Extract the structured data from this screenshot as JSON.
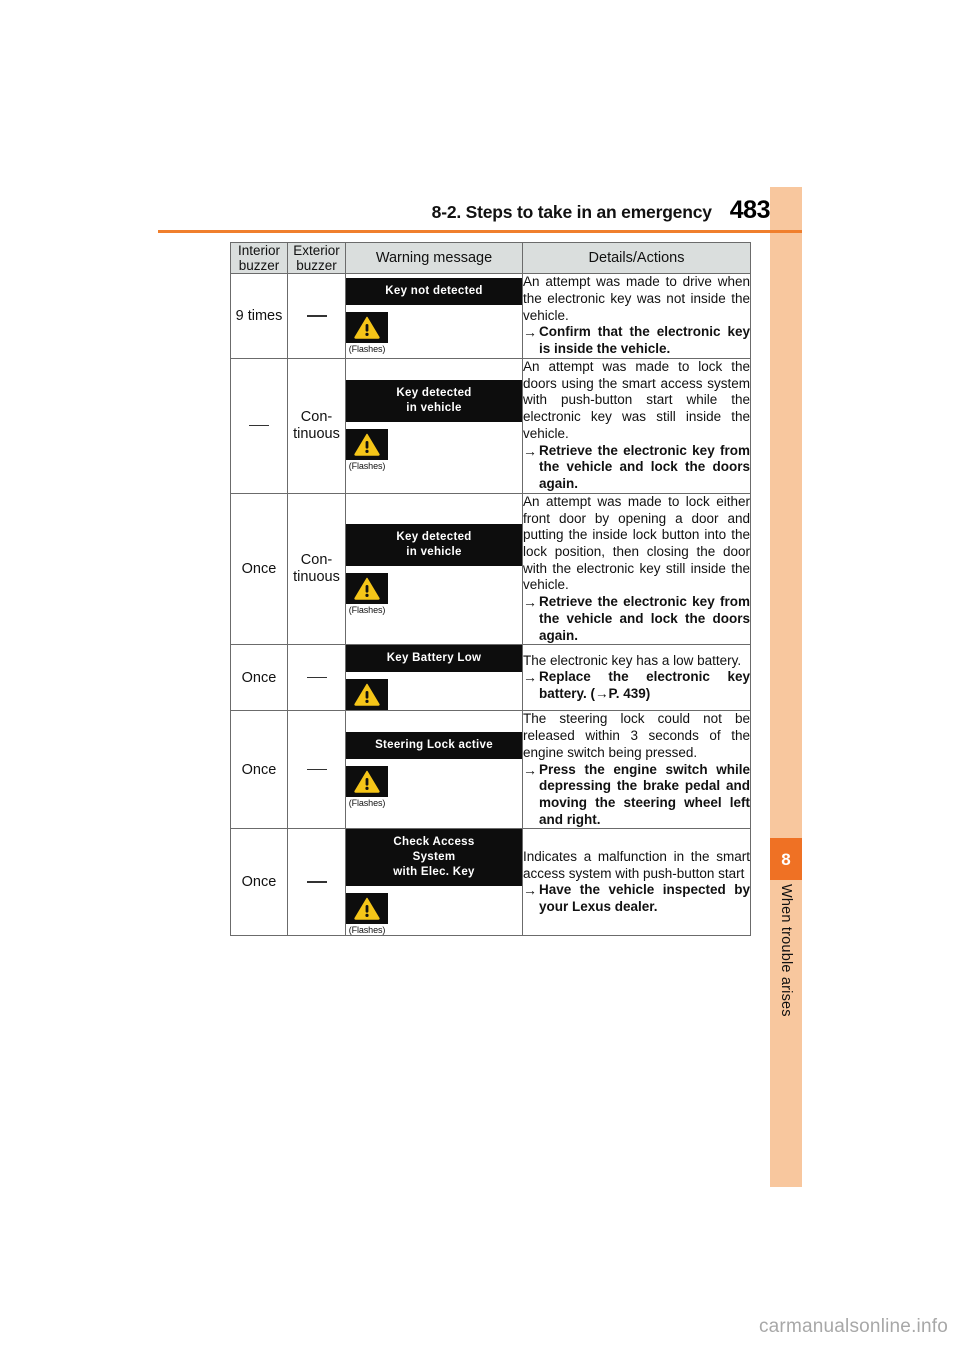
{
  "header": {
    "title": "8-2. Steps to take in an emergency",
    "page_number": "483",
    "rule_color": "#f07f2d"
  },
  "sidebar": {
    "chapter_number": "8",
    "chapter_label": "When trouble arises",
    "tab_color": "#ef7124",
    "band_color": "#f8c79e"
  },
  "table": {
    "columns": [
      "Interior buzzer",
      "Exterior buzzer",
      "Warning message",
      "Details/Actions"
    ],
    "columns_split": [
      {
        "line1": "Interior",
        "line2": "buzzer"
      },
      {
        "line1": "Exterior",
        "line2": "buzzer"
      }
    ],
    "header_bg": "#dadedd",
    "rows": [
      {
        "interior_buzzer": "9 times",
        "exterior_buzzer": "—",
        "message_lines": [
          "Key not detected"
        ],
        "icon": "warning-triangle-icon",
        "flashes_caption": "(Flashes)",
        "details": "An attempt was made to drive when the electronic key was not inside the vehicle.",
        "action_arrow": "→",
        "action": "Confirm that the electronic key is inside the vehicle."
      },
      {
        "interior_buzzer": "—",
        "exterior_buzzer": "Con-\ntinuous",
        "message_lines": [
          "Key detected",
          "in vehicle"
        ],
        "icon": "warning-triangle-icon",
        "flashes_caption": "(Flashes)",
        "details": "An attempt was made to lock the doors using the smart access system with push-button start while the electronic key was still inside the vehicle.",
        "action_arrow": "→",
        "action": "Retrieve the electronic key from the vehicle and lock the doors again."
      },
      {
        "interior_buzzer": "Once",
        "exterior_buzzer": "Con-\ntinuous",
        "message_lines": [
          "Key detected",
          "in vehicle"
        ],
        "icon": "warning-triangle-icon",
        "flashes_caption": "(Flashes)",
        "details": "An attempt was made to lock either front door by opening a door and putting the inside lock button into the lock position, then closing the door with the electronic key still inside the vehicle.",
        "action_arrow": "→",
        "action": "Retrieve the electronic key from the vehicle and lock the doors again."
      },
      {
        "interior_buzzer": "Once",
        "exterior_buzzer": "—",
        "message_lines": [
          "Key Battery Low"
        ],
        "icon": "warning-triangle-icon",
        "flashes_caption": "",
        "details": "The electronic key has a low battery.",
        "action_arrow": "→",
        "action": "Replace the electronic key battery. (→P. 439)"
      },
      {
        "interior_buzzer": "Once",
        "exterior_buzzer": "—",
        "message_lines": [
          "Steering Lock active"
        ],
        "icon": "warning-triangle-icon",
        "flashes_caption": "(Flashes)",
        "details": "The steering lock could not be released within 3 seconds of the engine switch being pressed.",
        "action_arrow": "→",
        "action": "Press the engine switch while depressing the brake pedal and moving the steering wheel left and right."
      },
      {
        "interior_buzzer": "Once",
        "exterior_buzzer": "—",
        "message_lines": [
          "Check Access",
          "System",
          "with Elec. Key"
        ],
        "icon": "warning-triangle-icon",
        "flashes_caption": "(Flashes)",
        "details": "Indicates a malfunction in the smart access system with push-button start",
        "action_arrow": "→",
        "action": "Have the vehicle inspected by your Lexus dealer."
      }
    ]
  },
  "watermark": "carmanualsonline.info"
}
